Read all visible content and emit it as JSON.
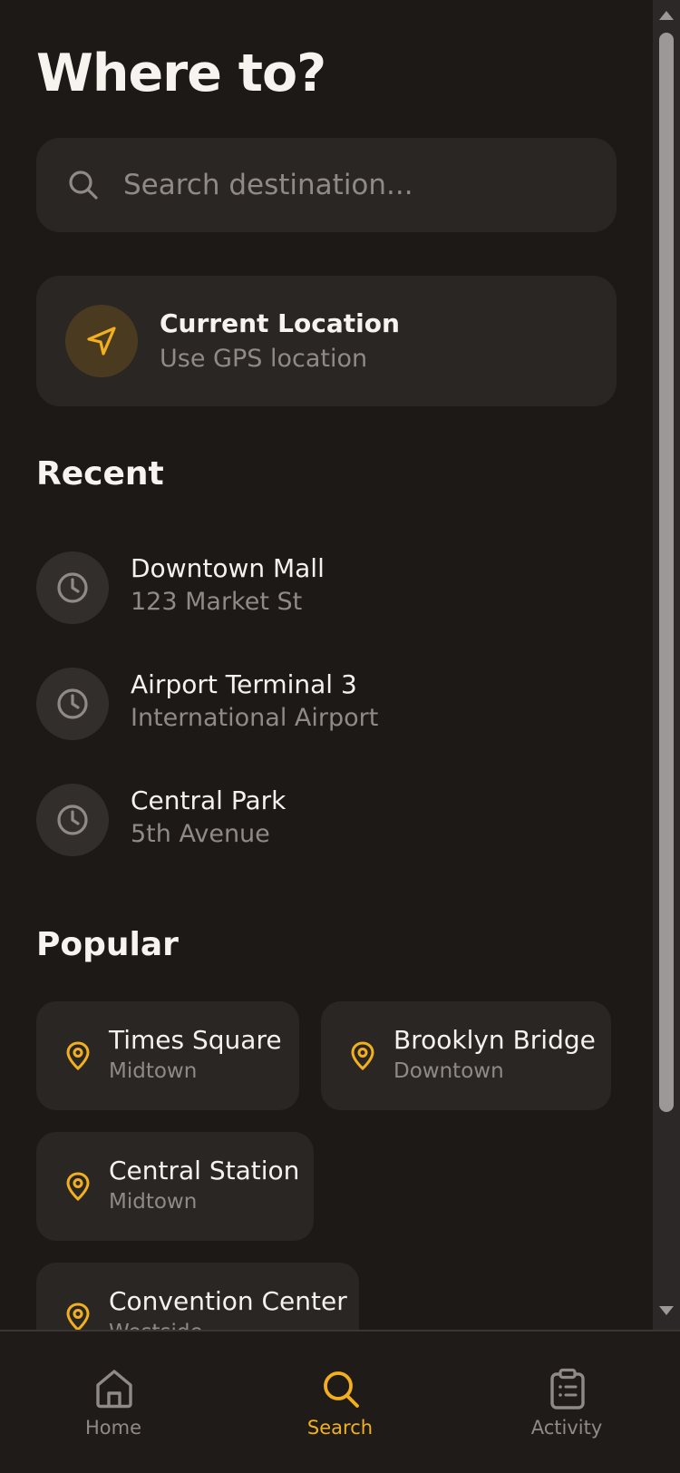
{
  "page": {
    "title": "Where to?"
  },
  "search": {
    "placeholder": "Search destination..."
  },
  "current_location": {
    "title": "Current Location",
    "subtitle": "Use GPS location",
    "icon": "navigation-arrow-icon"
  },
  "recent": {
    "heading": "Recent",
    "items": [
      {
        "name": "Downtown Mall",
        "address": "123 Market St",
        "icon": "clock-icon"
      },
      {
        "name": "Airport Terminal 3",
        "address": "International Airport",
        "icon": "clock-icon"
      },
      {
        "name": "Central Park",
        "address": "5th Avenue",
        "icon": "clock-icon"
      }
    ]
  },
  "popular": {
    "heading": "Popular",
    "items": [
      {
        "name": "Times Square",
        "area": "Midtown",
        "icon": "map-pin-icon"
      },
      {
        "name": "Brooklyn Bridge",
        "area": "Downtown",
        "icon": "map-pin-icon"
      },
      {
        "name": "Central Station",
        "area": "Midtown",
        "icon": "map-pin-icon"
      },
      {
        "name": "Convention Center",
        "area": "Westside",
        "icon": "map-pin-icon"
      }
    ]
  },
  "nav": {
    "items": [
      {
        "label": "Home",
        "icon": "home-icon",
        "active": false
      },
      {
        "label": "Search",
        "icon": "search-icon",
        "active": true
      },
      {
        "label": "Activity",
        "icon": "clipboard-list-icon",
        "active": false
      }
    ]
  },
  "colors": {
    "background": "#1d1917",
    "card": "#2a2624",
    "accent": "#f2b01e",
    "text_primary": "#f5f2ee",
    "text_secondary": "#8f8a86"
  }
}
